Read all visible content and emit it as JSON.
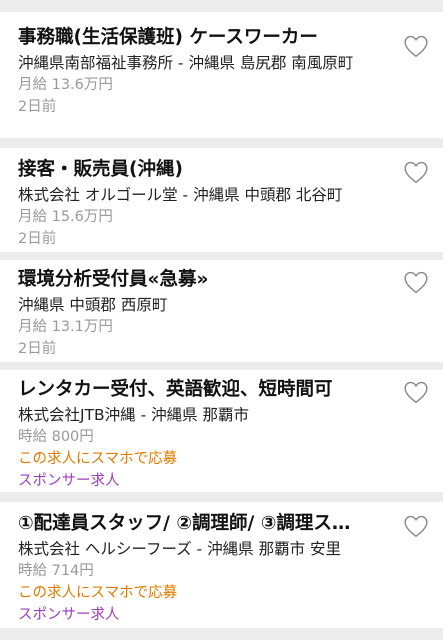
{
  "jobs": [
    {
      "title": "事務職(生活保護班) ケースワーカー",
      "company": "沖縄県南部福祉事務所 - 沖縄県 島尻郡 南風原町",
      "salary": "月給 13.6万円",
      "date": "2日前"
    },
    {
      "title": "接客・販売員(沖縄)",
      "company": "株式会社 オルゴール堂 - 沖縄県 中頭郡 北谷町",
      "salary": "月給 15.6万円",
      "date": "2日前"
    },
    {
      "title": "環境分析受付員«急募»",
      "company": "沖縄県 中頭郡 西原町",
      "salary": "月給 13.1万円",
      "date": "2日前"
    },
    {
      "title": "レンタカー受付、英語歓迎、短時間可",
      "company": "株式会社JTB沖縄 - 沖縄県 那覇市",
      "salary": "時給 800円",
      "apply": "この求人にスマホで応募",
      "sponsor": "スポンサー求人"
    },
    {
      "title": "①配達員スタッフ/ ②調理師/ ③調理ス…",
      "company": "株式会社 ヘルシーフーズ - 沖縄県 那覇市 安里",
      "salary": "時給 714円",
      "apply": "この求人にスマホで応募",
      "sponsor": "スポンサー求人"
    }
  ],
  "icons": {
    "favorite": "heart-outline-icon"
  },
  "colors": {
    "apply": "#e07b00",
    "sponsor": "#9b3fbf",
    "muted": "#9a9a9a"
  }
}
